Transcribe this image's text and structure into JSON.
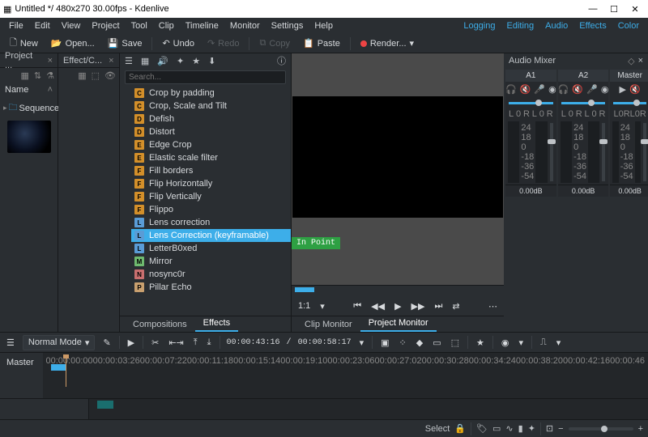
{
  "window": {
    "title": "Untitled */ 480x270 30.00fps - Kdenlive"
  },
  "menubar": {
    "items": [
      "File",
      "Edit",
      "View",
      "Project",
      "Tool",
      "Clip",
      "Timeline",
      "Monitor",
      "Settings",
      "Help"
    ],
    "right": [
      "Logging",
      "Editing",
      "Audio",
      "Effects",
      "Color"
    ]
  },
  "toolbar": {
    "new": "New",
    "open": "Open...",
    "save": "Save",
    "undo": "Undo",
    "redo": "Redo",
    "copy": "Copy",
    "paste": "Paste",
    "render": "Render..."
  },
  "project_bin": {
    "tab": "Project ...",
    "name_header": "Name",
    "tree": [
      {
        "label": "Sequences"
      }
    ]
  },
  "effects_panel": {
    "tab": "Effect/C...",
    "search_placeholder": "Search...",
    "items": [
      {
        "l": "C",
        "label": "Crop by padding"
      },
      {
        "l": "C",
        "label": "Crop, Scale and Tilt"
      },
      {
        "l": "D",
        "label": "Defish"
      },
      {
        "l": "D",
        "label": "Distort"
      },
      {
        "l": "E",
        "label": "Edge Crop"
      },
      {
        "l": "E",
        "label": "Elastic scale filter"
      },
      {
        "l": "F",
        "label": "Fill borders"
      },
      {
        "l": "F",
        "label": "Flip Horizontally"
      },
      {
        "l": "F",
        "label": "Flip Vertically"
      },
      {
        "l": "F",
        "label": "Flippo"
      },
      {
        "l": "L",
        "label": "Lens correction"
      },
      {
        "l": "L",
        "label": "Lens Correction  (keyframable)",
        "selected": true
      },
      {
        "l": "L",
        "label": "LetterB0xed"
      },
      {
        "l": "M",
        "label": "Mirror"
      },
      {
        "l": "N",
        "label": "nosync0r"
      },
      {
        "l": "P",
        "label": "Pillar Echo"
      }
    ],
    "tabs": {
      "compositions": "Compositions",
      "effects": "Effects"
    }
  },
  "monitor": {
    "in_point": "In Point",
    "ratio": "1:1",
    "tabs": {
      "clip": "Clip Monitor",
      "project": "Project Monitor"
    }
  },
  "mixer": {
    "title": "Audio Mixer",
    "channels": [
      {
        "label": "A1",
        "db": "0.00dB"
      },
      {
        "label": "A2",
        "db": "0.00dB"
      }
    ],
    "master": {
      "label": "Master",
      "db": "0.00dB"
    },
    "scale": [
      "24",
      "18",
      "0",
      "-18",
      "-36",
      "-54"
    ]
  },
  "mid_toolbar": {
    "mode": "Normal Mode",
    "tc_current": "00:00:43:16",
    "tc_total": "00:00:58:17"
  },
  "timeline": {
    "master": "Master",
    "ticks": [
      "00:00:00:00",
      "00:00:03:26",
      "00:00:07:22",
      "00:00:11:18",
      "00:00:15:14",
      "00:00:19:10",
      "00:00:23:06",
      "00:00:27:02",
      "00:00:30:28",
      "00:00:34:24",
      "00:00:38:20",
      "00:00:42:16",
      "00:00:46"
    ]
  },
  "bottom": {
    "select": "Select"
  }
}
